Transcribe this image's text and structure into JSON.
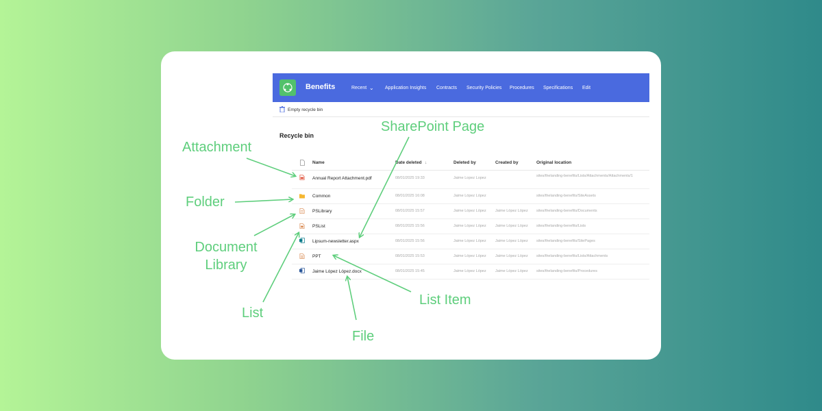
{
  "site": {
    "title": "Benefits",
    "nav": [
      "Recent",
      "Application Insights",
      "Contracts",
      "Security Policies",
      "Procedures",
      "Specifications",
      "Edit"
    ]
  },
  "command": {
    "empty_recycle_bin": "Empty recycle bin"
  },
  "page": {
    "heading": "Recycle bin"
  },
  "table": {
    "columns": [
      "Name",
      "Date deleted",
      "Deleted by",
      "Created by",
      "Original location"
    ],
    "sort_indicator": "↓",
    "rows": [
      {
        "name": "Annual Report Attachment.pdf",
        "date": "08/01/2025 19:33",
        "deleted_by": "Jaime Lopez Lopez",
        "created_by": "",
        "location": "sites/thelanding-benefits/Lists/Attachments/Attachments/1",
        "icon": "pdf-icon"
      },
      {
        "name": "Common",
        "date": "08/01/2025 16:08",
        "deleted_by": "Jaime López López",
        "created_by": "",
        "location": "sites/thelanding-benefits/SiteAssets",
        "icon": "folder-icon"
      },
      {
        "name": "PSLibrary",
        "date": "08/01/2025 15:57",
        "deleted_by": "Jaime López López",
        "created_by": "Jaime López López",
        "location": "sites/thelanding-benefits/Documents",
        "icon": "library-icon"
      },
      {
        "name": "PSList",
        "date": "08/01/2025 15:56",
        "deleted_by": "Jaime López López",
        "created_by": "Jaime López López",
        "location": "sites/thelanding-benefits/Lists",
        "icon": "list-icon"
      },
      {
        "name": "Lipsum-newsletter.aspx",
        "date": "08/01/2025 15:56",
        "deleted_by": "Jaime López López",
        "created_by": "Jaime López López",
        "location": "sites/thelanding-benefits/SitePages",
        "icon": "page-icon"
      },
      {
        "name": "PPT",
        "date": "08/01/2025 15:53",
        "deleted_by": "Jaime López López",
        "created_by": "Jaime López López",
        "location": "sites/thelanding-benefits/Lists/Attachments",
        "icon": "list-item-icon"
      },
      {
        "name": "Jaime López López.docx",
        "date": "08/01/2025 15:45",
        "deleted_by": "Jaime López López",
        "created_by": "Jaime López López",
        "location": "sites/thelanding-benefits/Procedures",
        "icon": "word-icon"
      }
    ]
  },
  "annotations": {
    "attachment": "Attachment",
    "folder": "Folder",
    "document_library_1": "Document",
    "document_library_2": "Library",
    "list": "List",
    "sharepoint_page": "SharePoint Page",
    "list_item": "List Item",
    "file": "File"
  },
  "colors": {
    "accent": "#4a6adf",
    "annotation": "#5ece7c",
    "logo": "#52c16c",
    "folder": "#f5b731",
    "word": "#2b579a",
    "pdf": "#e0533c"
  }
}
